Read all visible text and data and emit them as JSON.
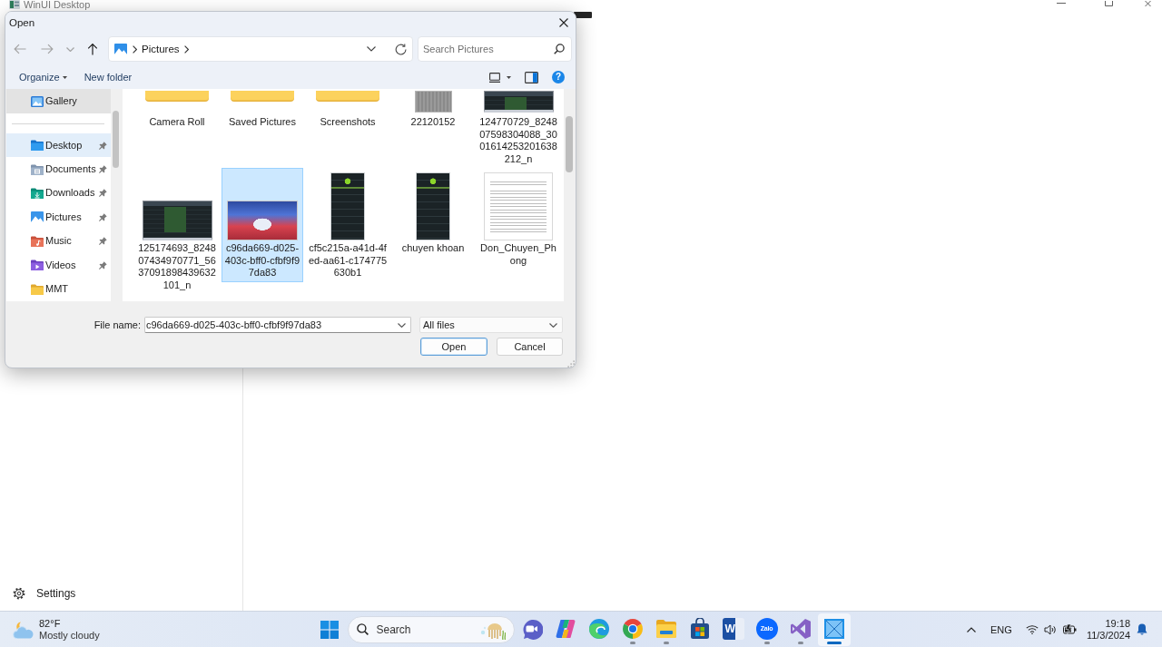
{
  "app": {
    "title": "WinUI Desktop",
    "nav_footer": {
      "label": "Settings"
    }
  },
  "dialog": {
    "title": "Open",
    "nav_buttons": [
      {
        "kind": "back",
        "disabled": true
      },
      {
        "kind": "forward",
        "disabled": true
      },
      {
        "kind": "recent",
        "disabled": true
      },
      {
        "kind": "up",
        "disabled": false
      }
    ],
    "address": {
      "crumbs": [
        "Pictures"
      ]
    },
    "search": {
      "placeholder": "Search Pictures"
    },
    "commands": [
      {
        "kind": "menu",
        "label": "Organize"
      },
      {
        "kind": "button",
        "label": "New folder"
      }
    ],
    "help": {
      "label": "?"
    },
    "sidebar": {
      "sections": [
        {
          "items": [
            {
              "label": "Gallery",
              "kind": "gallery",
              "selected": false,
              "hovered": true,
              "pinned": false
            }
          ]
        },
        {
          "items": [
            {
              "label": "Desktop",
              "kind": "desktop",
              "selected": true,
              "hovered": false,
              "pinned": true
            },
            {
              "label": "Documents",
              "kind": "documents",
              "selected": false,
              "hovered": false,
              "pinned": true
            },
            {
              "label": "Downloads",
              "kind": "downloads",
              "selected": false,
              "hovered": false,
              "pinned": true
            },
            {
              "label": "Pictures",
              "kind": "pictures",
              "selected": false,
              "hovered": false,
              "pinned": true
            },
            {
              "label": "Music",
              "kind": "music",
              "selected": false,
              "hovered": false,
              "pinned": true
            },
            {
              "label": "Videos",
              "kind": "videos",
              "selected": false,
              "hovered": false,
              "pinned": true
            },
            {
              "label": "MMT",
              "kind": "folder",
              "selected": false,
              "hovered": false,
              "pinned": false
            }
          ]
        }
      ]
    },
    "files": [
      {
        "label_lines": [
          "Camera Roll"
        ],
        "kind": "folder",
        "selected": false
      },
      {
        "label_lines": [
          "Saved Pictures"
        ],
        "kind": "folder",
        "selected": false
      },
      {
        "label_lines": [
          "Screenshots"
        ],
        "kind": "folder",
        "selected": false
      },
      {
        "label_lines": [
          "22120152"
        ],
        "kind": "photo",
        "selected": false
      },
      {
        "label_lines": [
          "124770729_8248",
          "07598304088_30",
          "01614253201638",
          "212_n"
        ],
        "kind": "screenshot",
        "selected": false
      },
      {
        "label_lines": [
          "125174693_8248",
          "07434970771_56",
          "37091898439632",
          "101_n"
        ],
        "kind": "screenshot",
        "selected": false
      },
      {
        "label_lines": [
          "c96da669-d025-",
          "403c-bff0-cfbf9f9",
          "7da83"
        ],
        "kind": "illustration",
        "selected": true
      },
      {
        "label_lines": [
          "cf5c215a-a41d-4f",
          "ed-aa61-c174775",
          "630b1"
        ],
        "kind": "phone",
        "selected": false
      },
      {
        "label_lines": [
          "chuyen khoan"
        ],
        "kind": "phone",
        "selected": false
      },
      {
        "label_lines": [
          "Don_Chuyen_Ph",
          "ong"
        ],
        "kind": "document",
        "selected": false
      }
    ],
    "file_name": {
      "label": "File name:",
      "value": "c96da669-d025-403c-bff0-cfbf9f97da83"
    },
    "file_type": {
      "value": "All files"
    },
    "buttons": [
      {
        "label": "Open",
        "default": true
      },
      {
        "label": "Cancel",
        "default": false
      }
    ]
  },
  "taskbar": {
    "weather": {
      "temperature": "82°F",
      "condition": "Mostly cloudy"
    },
    "search": {
      "placeholder": "Search"
    },
    "apps": [
      {
        "kind": "videocall",
        "running": false,
        "active": false
      },
      {
        "kind": "ribbon",
        "running": false,
        "active": false
      },
      {
        "kind": "swirl",
        "running": false,
        "active": false
      },
      {
        "kind": "wheel",
        "running": true,
        "active": false
      },
      {
        "kind": "folder",
        "running": true,
        "active": false
      },
      {
        "kind": "bag",
        "running": false,
        "active": false
      },
      {
        "kind": "letter",
        "label": "W",
        "running": false,
        "active": false
      },
      {
        "kind": "bubble",
        "label": "Zalo",
        "running": true,
        "active": false
      },
      {
        "kind": "loop",
        "running": true,
        "active": false
      },
      {
        "kind": "crossbox",
        "running": true,
        "active": true
      }
    ],
    "tray": {
      "language": "ENG",
      "time": "19:18",
      "date": "11/3/2024"
    }
  }
}
